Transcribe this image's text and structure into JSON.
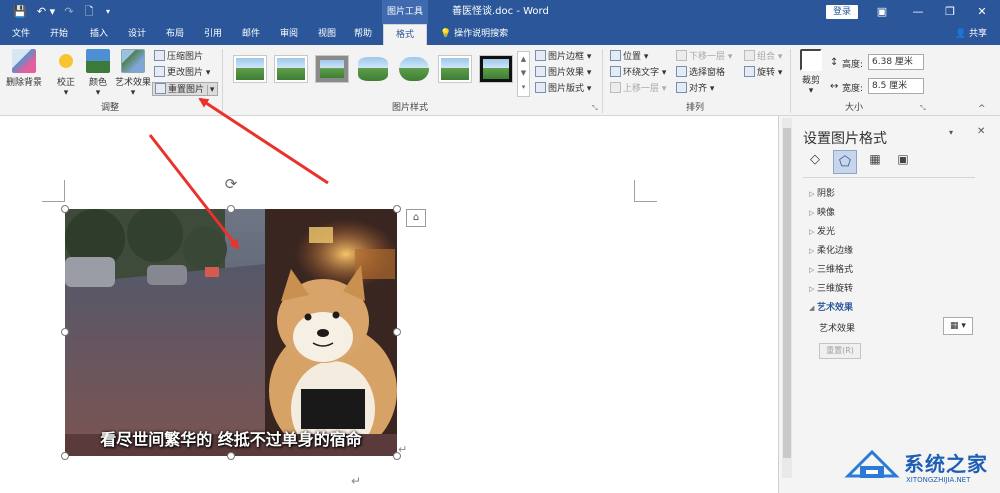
{
  "titlebar": {
    "context_group": "图片工具",
    "doc_title": "善医怪谈.doc  -  Word",
    "login": "登录",
    "qa_save": "💾",
    "qa_undo": "↶ ▾",
    "qa_redo": "↷",
    "qa_new": "🗋",
    "qa_more": "▾",
    "win_restore_ribbon": "▣",
    "win_min": "—",
    "win_max": "❐",
    "win_close": "✕"
  },
  "tabs": [
    {
      "label": "文件"
    },
    {
      "label": "开始"
    },
    {
      "label": "插入"
    },
    {
      "label": "设计"
    },
    {
      "label": "布局"
    },
    {
      "label": "引用"
    },
    {
      "label": "邮件"
    },
    {
      "label": "审阅"
    },
    {
      "label": "视图"
    },
    {
      "label": "帮助"
    },
    {
      "label": "格式",
      "active": true
    }
  ],
  "tell_me": "操作说明搜索",
  "share": "共享",
  "ribbon": {
    "adjust": {
      "remove_bg": "删除背景",
      "correct": "校正",
      "color": "颜色",
      "artistic": "艺术效果",
      "compress": "压缩图片",
      "change": "更改图片",
      "reset": "重置图片",
      "label": "调整"
    },
    "styles": {
      "border": "图片边框",
      "effects": "图片效果",
      "layout": "图片版式",
      "label": "图片样式",
      "thumb_count": 7
    },
    "arrange": {
      "position": "位置",
      "wrap": "环绕文字",
      "bring_forward": "上移一层",
      "send_backward": "下移一层",
      "selection_pane": "选择窗格",
      "align": "对齐",
      "group": "组合",
      "rotate": "旋转",
      "label": "排列"
    },
    "size": {
      "crop": "裁剪",
      "height_label": "高度:",
      "height_value": "6.38 厘米",
      "width_label": "宽度:",
      "width_value": "8.5 厘米",
      "label": "大小"
    }
  },
  "document": {
    "caption": "看尽世间繁华的 终抵不过单身的宿命",
    "paragraph_mark": "↵"
  },
  "pane": {
    "title": "设置图片格式",
    "sections": [
      {
        "label": "阴影",
        "expanded": false
      },
      {
        "label": "映像",
        "expanded": false
      },
      {
        "label": "发光",
        "expanded": false
      },
      {
        "label": "柔化边缘",
        "expanded": false
      },
      {
        "label": "三维格式",
        "expanded": false
      },
      {
        "label": "三维旋转",
        "expanded": false
      },
      {
        "label": "艺术效果",
        "expanded": true
      }
    ],
    "art_effect_label": "艺术效果",
    "reset_button": "重置(R)"
  },
  "watermark": {
    "text": "系统之家",
    "sub": "XITONGZHIJIA.NET"
  },
  "colors": {
    "word_blue": "#2b579a",
    "arrow_red": "#e8322b"
  }
}
